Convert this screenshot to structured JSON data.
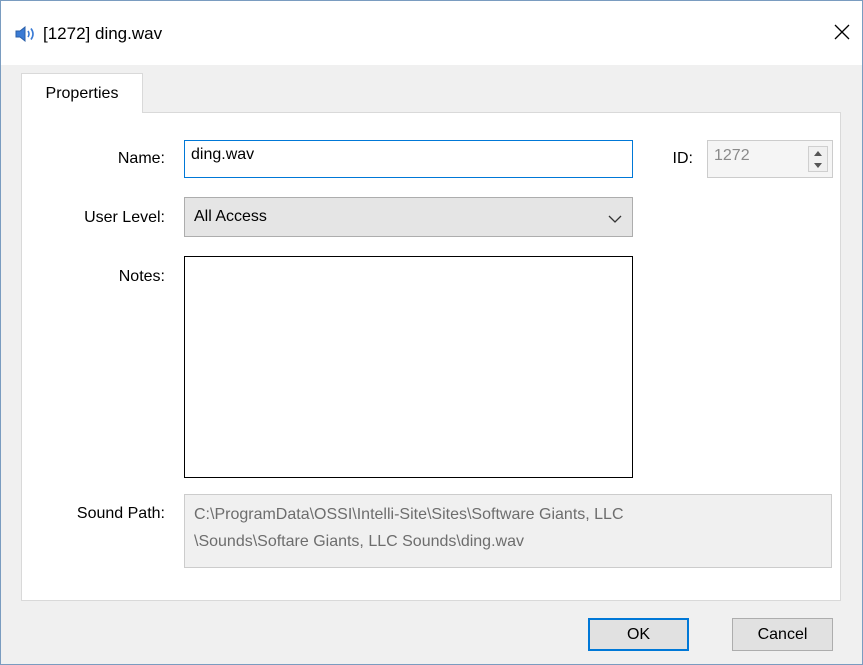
{
  "window": {
    "title": "[1272] ding.wav",
    "icon": "speaker-icon",
    "close_icon": "close-icon",
    "border_color": "#7a9cc0"
  },
  "tabs": [
    {
      "label": "Properties",
      "active": true
    }
  ],
  "form": {
    "name_label": "Name:",
    "name_value": "ding.wav",
    "id_label": "ID:",
    "id_value": "1272",
    "user_level_label": "User Level:",
    "user_level_value": "All Access",
    "notes_label": "Notes:",
    "notes_value": "",
    "sound_path_label": "Sound Path:",
    "sound_path_line1": "C:\\ProgramData\\OSSI\\Intelli-Site\\Sites\\Software Giants, LLC",
    "sound_path_line2": "\\Sounds\\Softare Giants, LLC Sounds\\ding.wav"
  },
  "buttons": {
    "ok_label": "OK",
    "cancel_label": "Cancel"
  },
  "colors": {
    "focus_accent": "#0078d7",
    "disabled_text": "#6d6d6d"
  }
}
